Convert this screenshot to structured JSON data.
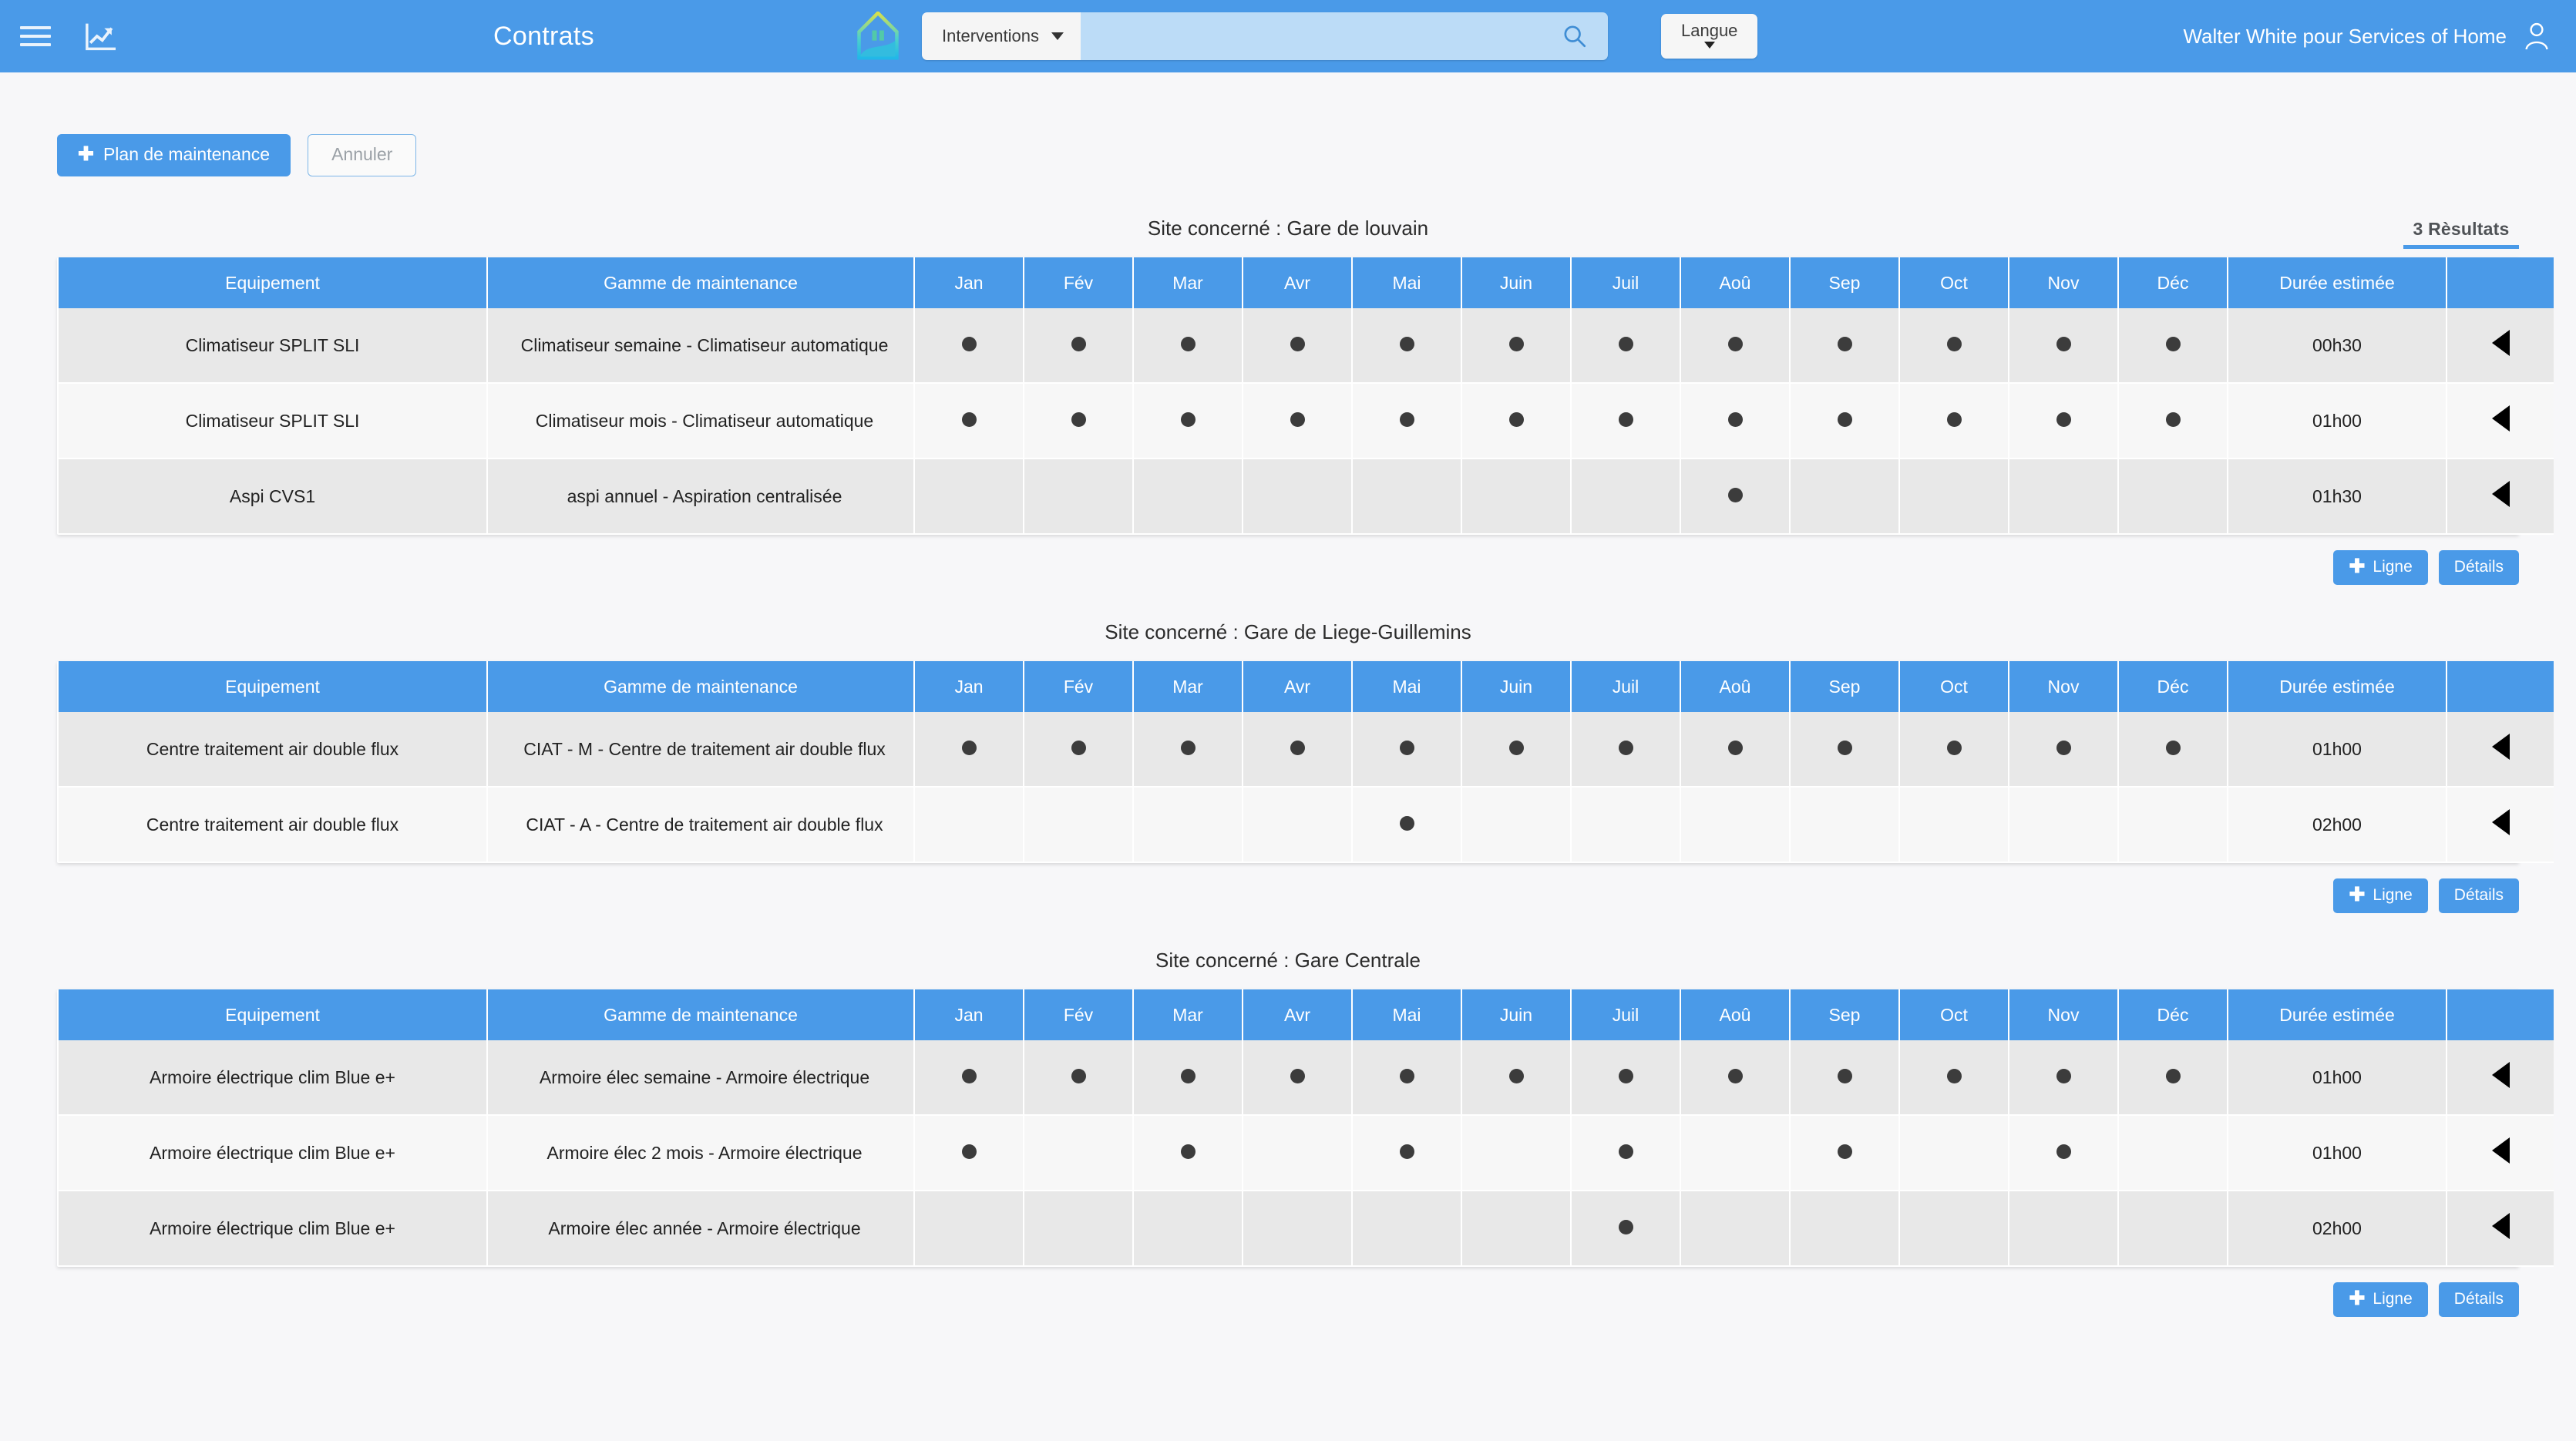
{
  "nav": {
    "menu_icon": "hamburger-icon",
    "chart_icon": "chart-icon",
    "title": "Contrats",
    "logo_icon": "home-logo-icon",
    "search": {
      "category": "Interventions",
      "value": "",
      "placeholder": "",
      "search_icon": "search-icon"
    },
    "language_label": "Langue",
    "user_label": "Walter White pour Services of Home",
    "user_icon": "user-icon"
  },
  "toolbar": {
    "add_plan_label": "Plan de maintenance",
    "cancel_label": "Annuler",
    "results_label": "3 Rèsultats"
  },
  "table_headers": {
    "equipement": "Equipement",
    "gamme": "Gamme de maintenance",
    "months": [
      "Jan",
      "Fév",
      "Mar",
      "Avr",
      "Mai",
      "Juin",
      "Juil",
      "Aoû",
      "Sep",
      "Oct",
      "Nov",
      "Déc"
    ],
    "duree": "Durée estimée",
    "actions": ""
  },
  "section_buttons": {
    "add_line_label": "Ligne",
    "details_label": "Détails"
  },
  "sections": [
    {
      "site_title": "Site concerné : Gare de louvain",
      "rows": [
        {
          "equipement": "Climatiseur SPLIT SLI",
          "gamme": "Climatiseur semaine - Climatiseur automatique",
          "months": [
            true,
            true,
            true,
            true,
            true,
            true,
            true,
            true,
            true,
            true,
            true,
            true
          ],
          "duree": "00h30"
        },
        {
          "equipement": "Climatiseur SPLIT SLI",
          "gamme": "Climatiseur mois - Climatiseur automatique",
          "months": [
            true,
            true,
            true,
            true,
            true,
            true,
            true,
            true,
            true,
            true,
            true,
            true
          ],
          "duree": "01h00"
        },
        {
          "equipement": "Aspi CVS1",
          "gamme": "aspi annuel - Aspiration centralisée",
          "months": [
            false,
            false,
            false,
            false,
            false,
            false,
            false,
            true,
            false,
            false,
            false,
            false
          ],
          "duree": "01h30"
        }
      ]
    },
    {
      "site_title": "Site concerné : Gare de Liege-Guillemins",
      "rows": [
        {
          "equipement": "Centre traitement air double flux",
          "gamme": "CIAT - M - Centre de traitement air double flux",
          "months": [
            true,
            true,
            true,
            true,
            true,
            true,
            true,
            true,
            true,
            true,
            true,
            true
          ],
          "duree": "01h00"
        },
        {
          "equipement": "Centre traitement air double flux",
          "gamme": "CIAT - A - Centre de traitement air double flux",
          "months": [
            false,
            false,
            false,
            false,
            true,
            false,
            false,
            false,
            false,
            false,
            false,
            false
          ],
          "duree": "02h00"
        }
      ]
    },
    {
      "site_title": "Site concerné : Gare Centrale",
      "rows": [
        {
          "equipement": "Armoire électrique clim Blue e+",
          "gamme": "Armoire élec semaine - Armoire électrique",
          "months": [
            true,
            true,
            true,
            true,
            true,
            true,
            true,
            true,
            true,
            true,
            true,
            true
          ],
          "duree": "01h00"
        },
        {
          "equipement": "Armoire électrique clim Blue e+",
          "gamme": "Armoire élec 2 mois - Armoire électrique",
          "months": [
            true,
            false,
            true,
            false,
            true,
            false,
            true,
            false,
            true,
            false,
            true,
            false
          ],
          "duree": "01h00"
        },
        {
          "equipement": "Armoire électrique clim Blue e+",
          "gamme": "Armoire élec année - Armoire électrique",
          "months": [
            false,
            false,
            false,
            false,
            false,
            false,
            true,
            false,
            false,
            false,
            false,
            false
          ],
          "duree": "02h00"
        }
      ]
    }
  ],
  "colors": {
    "accent": "#4a9ae8",
    "header_text": "#ffffff",
    "page_bg": "#f7f7f9",
    "row_odd": "#e8e8e8",
    "row_even": "#f7f7f7",
    "dot": "#3c3c3c"
  }
}
